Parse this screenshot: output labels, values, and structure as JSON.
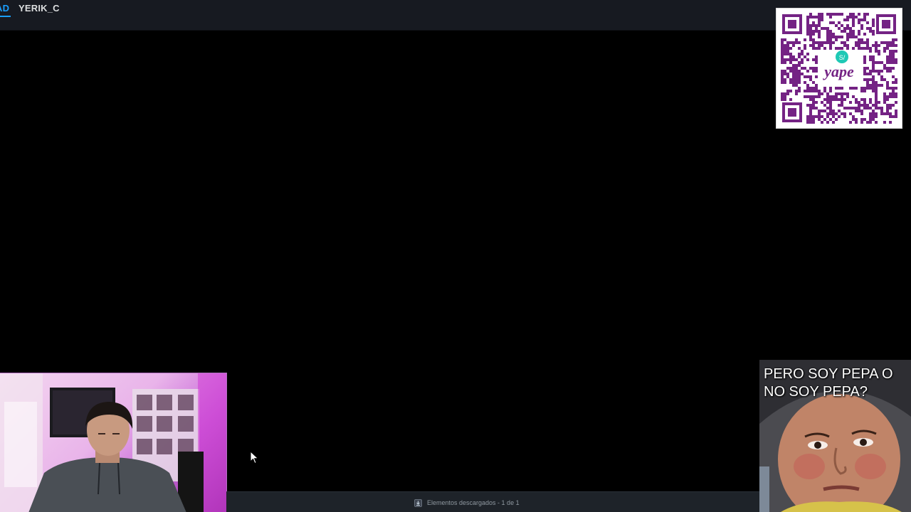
{
  "topbar": {
    "partial_tab_label": "AD",
    "username": "YERIK_C"
  },
  "overlays": {
    "qr_brand_text": "yape",
    "qr_badge_text": "S/",
    "meme_caption": "PERO SOY PEPA O NO SOY PEPA?"
  },
  "statusbar": {
    "download_text": "Elementos descargados - 1 de 1"
  },
  "icons": {
    "download": "download-icon",
    "cursor": "cursor-icon"
  },
  "colors": {
    "topbar_bg": "#171a21",
    "accent": "#1a9fff",
    "qr_purple": "#742384",
    "qr_teal": "#1ec9b5",
    "statusbar_bg": "#1e2329"
  }
}
